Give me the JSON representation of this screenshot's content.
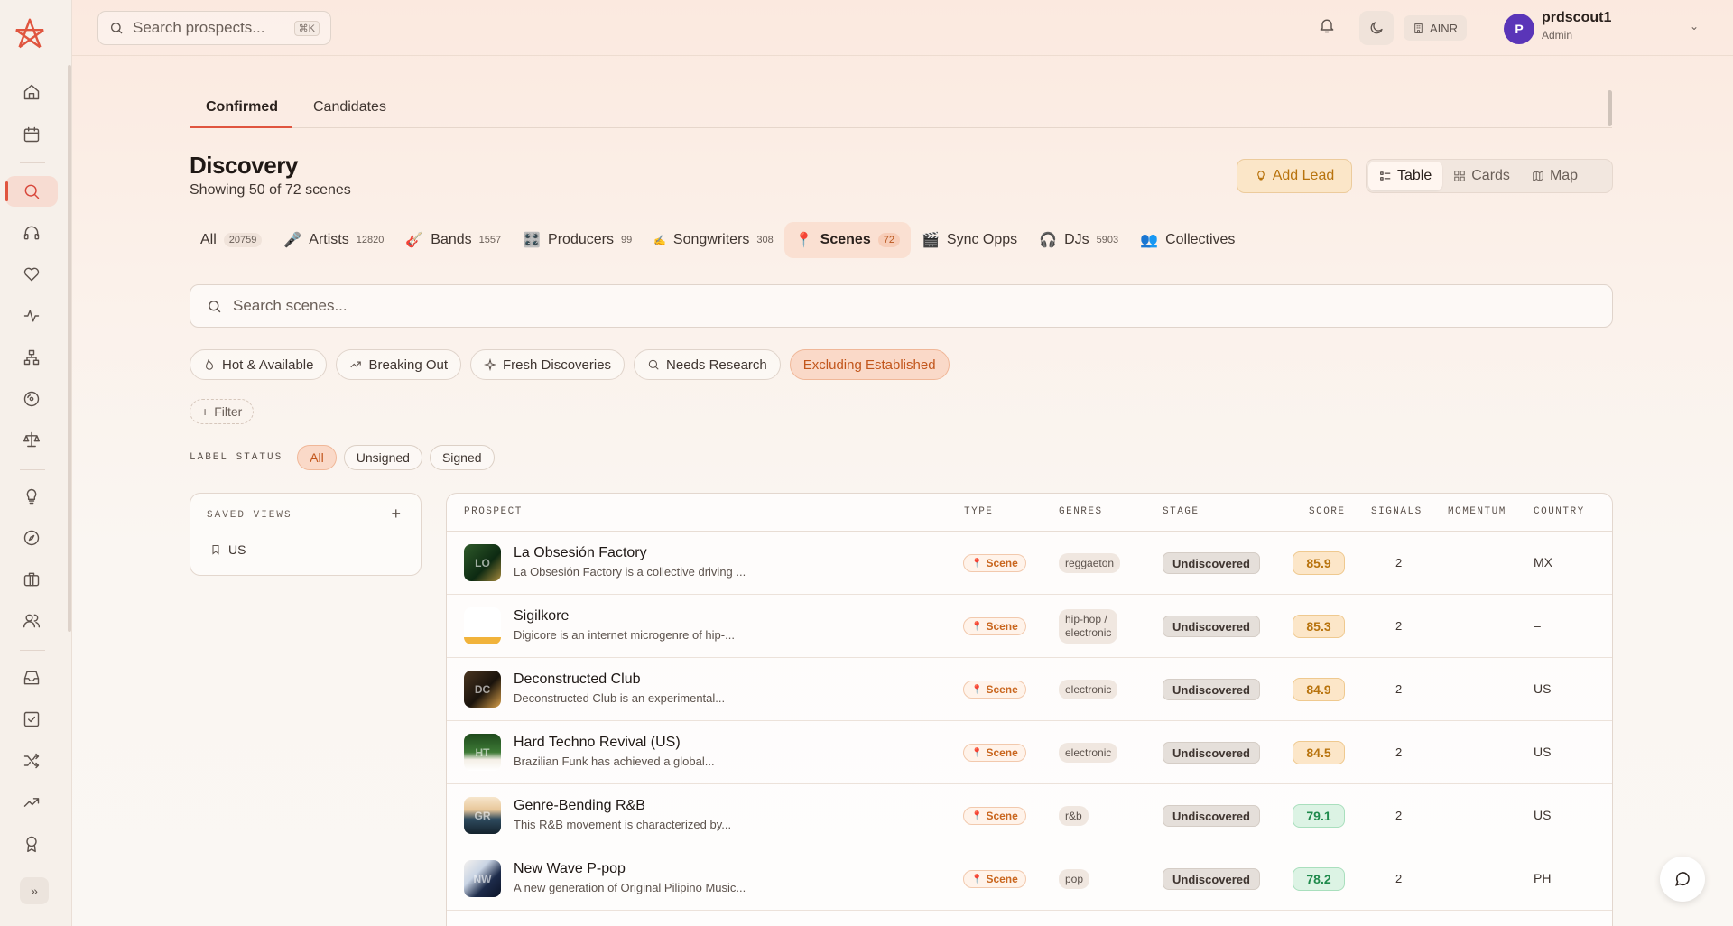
{
  "search": {
    "placeholder": "Search prospects...",
    "shortcut": "⌘K"
  },
  "org": {
    "label": "AINR"
  },
  "user": {
    "name": "prdscout1",
    "role": "Admin",
    "initial": "P"
  },
  "tabs": [
    "Confirmed",
    "Candidates"
  ],
  "page": {
    "title": "Discovery",
    "subtitle": "Showing 50 of 72 scenes"
  },
  "actions": {
    "add_lead": "Add Lead",
    "views": [
      "Table",
      "Cards",
      "Map"
    ]
  },
  "categories": [
    {
      "label": "All",
      "count": "20759",
      "icon": "",
      "active": false
    },
    {
      "label": "Artists",
      "count": "12820",
      "icon": "🎤",
      "active": false
    },
    {
      "label": "Bands",
      "count": "1557",
      "icon": "🎸",
      "active": false
    },
    {
      "label": "Producers",
      "count": "99",
      "icon": "🎛️",
      "active": false
    },
    {
      "label": "Songwriters",
      "count": "308",
      "icon": "✍️",
      "active": false
    },
    {
      "label": "Scenes",
      "count": "72",
      "icon": "📍",
      "active": true
    },
    {
      "label": "Sync Opps",
      "count": "",
      "icon": "🎬",
      "active": false
    },
    {
      "label": "DJs",
      "count": "5903",
      "icon": "🎧",
      "active": false
    },
    {
      "label": "Collectives",
      "count": "",
      "icon": "👥",
      "active": false
    }
  ],
  "scene_search": {
    "placeholder": "Search scenes..."
  },
  "quick_filters": [
    "Hot & Available",
    "Breaking Out",
    "Fresh Discoveries",
    "Needs Research",
    "Excluding Established"
  ],
  "add_filter": "Filter",
  "label_status": {
    "caption": "LABEL STATUS",
    "options": [
      "All",
      "Unsigned",
      "Signed"
    ],
    "selected": "All"
  },
  "saved_views": {
    "title": "SAVED VIEWS",
    "items": [
      "US"
    ]
  },
  "table": {
    "headers": [
      "PROSPECT",
      "TYPE",
      "GENRES",
      "STAGE",
      "SCORE",
      "SIGNALS",
      "MOMENTUM",
      "COUNTRY"
    ],
    "rows": [
      {
        "initials": "LO",
        "name": "La Obsesión Factory",
        "desc": "La Obsesión Factory is a collective driving ...",
        "type": "Scene",
        "genres": [
          "reggaeton"
        ],
        "stage": "Undiscovered",
        "score": "85.9",
        "score_color": "amber",
        "signals": "2",
        "country": "MX"
      },
      {
        "initials": "",
        "name": "Sigilkore",
        "desc": "Digicore is an internet microgenre of hip-...",
        "type": "Scene",
        "genres": [
          "hip-hop /",
          "electronic"
        ],
        "stage": "Undiscovered",
        "score": "85.3",
        "score_color": "amber",
        "signals": "2",
        "country": "–"
      },
      {
        "initials": "DC",
        "name": "Deconstructed Club",
        "desc": "Deconstructed Club is an experimental...",
        "type": "Scene",
        "genres": [
          "electronic"
        ],
        "stage": "Undiscovered",
        "score": "84.9",
        "score_color": "amber",
        "signals": "2",
        "country": "US"
      },
      {
        "initials": "HT",
        "name": "Hard Techno Revival (US)",
        "desc": "Brazilian Funk has achieved a global...",
        "type": "Scene",
        "genres": [
          "electronic"
        ],
        "stage": "Undiscovered",
        "score": "84.5",
        "score_color": "amber",
        "signals": "2",
        "country": "US"
      },
      {
        "initials": "GR",
        "name": "Genre-Bending R&B",
        "desc": "This R&B movement is characterized by...",
        "type": "Scene",
        "genres": [
          "r&b"
        ],
        "stage": "Undiscovered",
        "score": "79.1",
        "score_color": "green",
        "signals": "2",
        "country": "US"
      },
      {
        "initials": "NW",
        "name": "New Wave P-pop",
        "desc": "A new generation of Original Pilipino Music...",
        "type": "Scene",
        "genres": [
          "pop"
        ],
        "stage": "Undiscovered",
        "score": "78.2",
        "score_color": "green",
        "signals": "2",
        "country": "PH"
      }
    ]
  },
  "colors": {
    "accent": "#e0553f",
    "amber": "#b8730d",
    "green": "#1f8a4c"
  }
}
